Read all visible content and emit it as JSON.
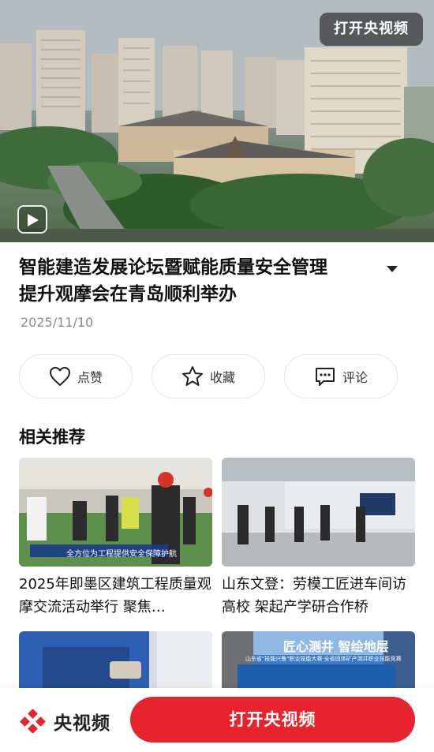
{
  "hero": {
    "open_button": "打开央视频"
  },
  "article": {
    "title_line1": "智能建造发展论坛暨赋能质量安全管理",
    "title_line2": "提升观摩会在青岛顺利举办",
    "date": "2025/11/10"
  },
  "actions": [
    {
      "label": "点赞",
      "icon": "heart-icon"
    },
    {
      "label": "收藏",
      "icon": "star-icon"
    },
    {
      "label": "评论",
      "icon": "comment-icon"
    }
  ],
  "related": {
    "heading": "相关推荐",
    "items": [
      {
        "title": "2025年即墨区建筑工程质量观摩交流活动举行 聚焦…",
        "banner": "全方位为工程提供安全保障护航"
      },
      {
        "title": "山东文登：劳模工匠进车间访高校 架起产学研合作桥"
      },
      {
        "title": ""
      },
      {
        "title": "",
        "banner_title": "匠心测井 智绘地层",
        "banner_sub": "山东省\"技能兴鲁\"职业技能大赛·全省固体矿产测井职业技能竞赛"
      }
    ]
  },
  "bottom_bar": {
    "brand": "央视频",
    "open_button": "打开央视频"
  },
  "colors": {
    "accent": "#e7232d"
  }
}
